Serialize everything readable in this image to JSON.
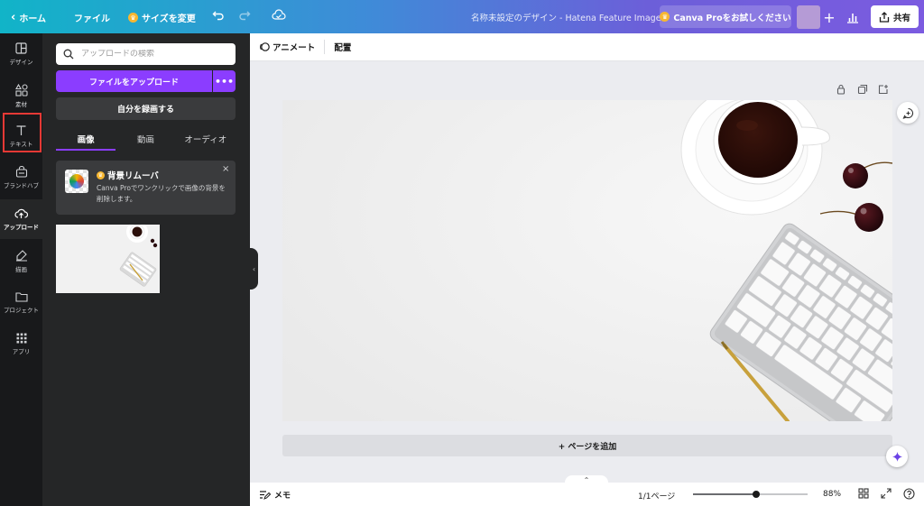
{
  "topbar": {
    "home_label": "ホーム",
    "file_label": "ファイル",
    "resize_label": "サイズを変更",
    "doc_title": "名称未設定のデザイン - Hatena Feature Image",
    "pro_label": "Canva Proをお試しください",
    "share_label": "共有",
    "icons": [
      "chevron-left-icon",
      "crown-icon",
      "undo-icon",
      "redo-icon",
      "cloud-saved-icon",
      "plus-icon",
      "chart-icon",
      "share-icon"
    ],
    "gradient": [
      "#11b4c8",
      "#7b5be0"
    ]
  },
  "leftnav": {
    "items": [
      {
        "label": "デザイン",
        "icon": "layout-icon"
      },
      {
        "label": "素材",
        "icon": "elements-icon"
      },
      {
        "label": "テキスト",
        "icon": "text-icon"
      },
      {
        "label": "ブランドハブ",
        "icon": "brand-icon"
      },
      {
        "label": "アップロード",
        "icon": "upload-icon"
      },
      {
        "label": "描画",
        "icon": "draw-icon"
      },
      {
        "label": "プロジェクト",
        "icon": "folder-icon"
      },
      {
        "label": "アプリ",
        "icon": "apps-icon"
      }
    ],
    "active": "アップロード",
    "highlight_color": "#e53935"
  },
  "panel": {
    "search_placeholder": "アップロードの検索",
    "upload_button": "ファイルをアップロード",
    "more_button": "•••",
    "record_button": "自分を録画する",
    "tabs": [
      "画像",
      "動画",
      "オーディオ"
    ],
    "active_tab": "画像",
    "bg_remover": {
      "title": "背景リムーバ",
      "desc": "Canva Proでワンクリックで画像の背景を削除します。",
      "close": "×"
    },
    "accent": "#8b3dff"
  },
  "ctxbar": {
    "animate_label": "アニメート",
    "position_label": "配置"
  },
  "canvas": {
    "add_page_label": "+ ページを追加"
  },
  "bottombar": {
    "memo_label": "メモ",
    "page_count": "1/1ページ",
    "zoom_label": "88%",
    "zoom_fraction": 0.55
  }
}
